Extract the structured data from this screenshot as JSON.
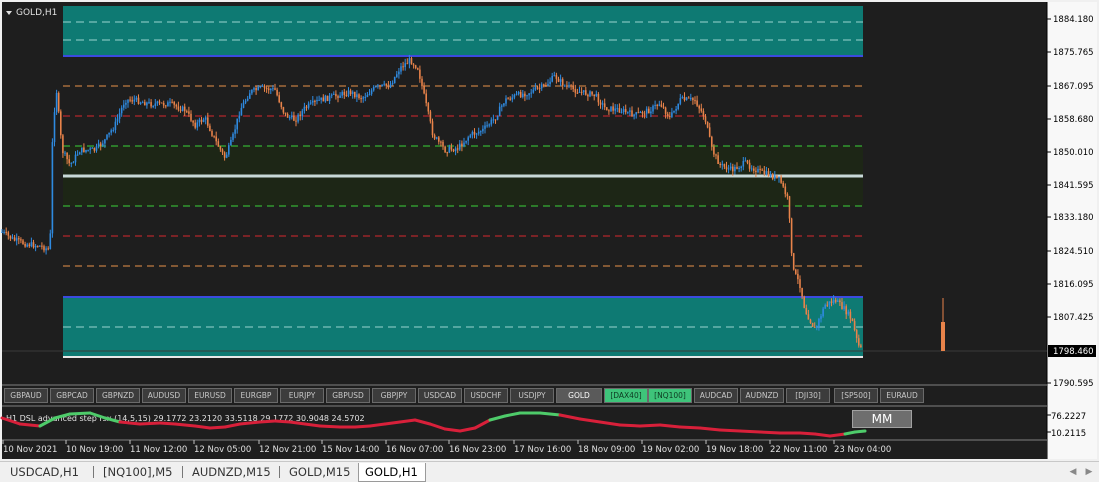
{
  "chart": {
    "symbol_label": "GOLD,H1",
    "price_labels": [
      "1884.180",
      "1875.765",
      "1867.095",
      "1858.680",
      "1850.010",
      "1841.595",
      "1833.180",
      "1824.510",
      "1816.095",
      "1807.425",
      "1798.460",
      "1790.595"
    ],
    "current_price": "1798.460",
    "time_labels": [
      "10 Nov 2021",
      "10 Nov 19:00",
      "11 Nov 12:00",
      "12 Nov 05:00",
      "12 Nov 21:00",
      "15 Nov 14:00",
      "16 Nov 07:00",
      "16 Nov 23:00",
      "17 Nov 16:00",
      "18 Nov 09:00",
      "19 Nov 02:00",
      "19 Nov 18:00",
      "22 Nov 11:00",
      "23 Nov 04:00"
    ],
    "colors": {
      "background": "#1e1e1e",
      "bull_candle": "#2f8ae0",
      "bear_candle": "#e8834a",
      "supply_zone": "#0e7a73",
      "mid_line": "#c8d8d8",
      "blue_line": "#3b4be0"
    }
  },
  "symbol_buttons": [
    {
      "label": "GBPAUD",
      "state": "normal"
    },
    {
      "label": "GBPCAD",
      "state": "normal"
    },
    {
      "label": "GBPNZD",
      "state": "normal"
    },
    {
      "label": "AUDUSD",
      "state": "normal"
    },
    {
      "label": "EURUSD",
      "state": "normal"
    },
    {
      "label": "EURGBP",
      "state": "normal"
    },
    {
      "label": "EURJPY",
      "state": "normal"
    },
    {
      "label": "GBPUSD",
      "state": "normal"
    },
    {
      "label": "GBPJPY",
      "state": "normal"
    },
    {
      "label": "USDCAD",
      "state": "normal"
    },
    {
      "label": "USDCHF",
      "state": "normal"
    },
    {
      "label": "USDJPY",
      "state": "normal"
    },
    {
      "label": "GOLD",
      "state": "active"
    },
    {
      "label": "[DAX40]",
      "state": "green"
    },
    {
      "label": "[NQ100]",
      "state": "green"
    },
    {
      "label": "AUDCAD",
      "state": "normal"
    },
    {
      "label": "AUDNZD",
      "state": "normal"
    },
    {
      "label": "[DJI30]",
      "state": "normal"
    },
    {
      "label": "[SP500]",
      "state": "normal"
    },
    {
      "label": "EURAUD",
      "state": "normal"
    }
  ],
  "indicator": {
    "label": "H1  DSL advanced step rsx (14,5,15) 29.1772 23.2120 33.5118 29.1772 30.9048 24.5702",
    "scale_top": "76.2227",
    "scale_bottom": "10.2115",
    "mm_button": "MM"
  },
  "tabs": [
    {
      "label": "USDCAD,H1",
      "active": false
    },
    {
      "label": "[NQ100],M5",
      "active": false
    },
    {
      "label": "AUDNZD,M15",
      "active": false
    },
    {
      "label": "GOLD,M15",
      "active": false
    },
    {
      "label": "GOLD,H1",
      "active": true
    }
  ]
}
